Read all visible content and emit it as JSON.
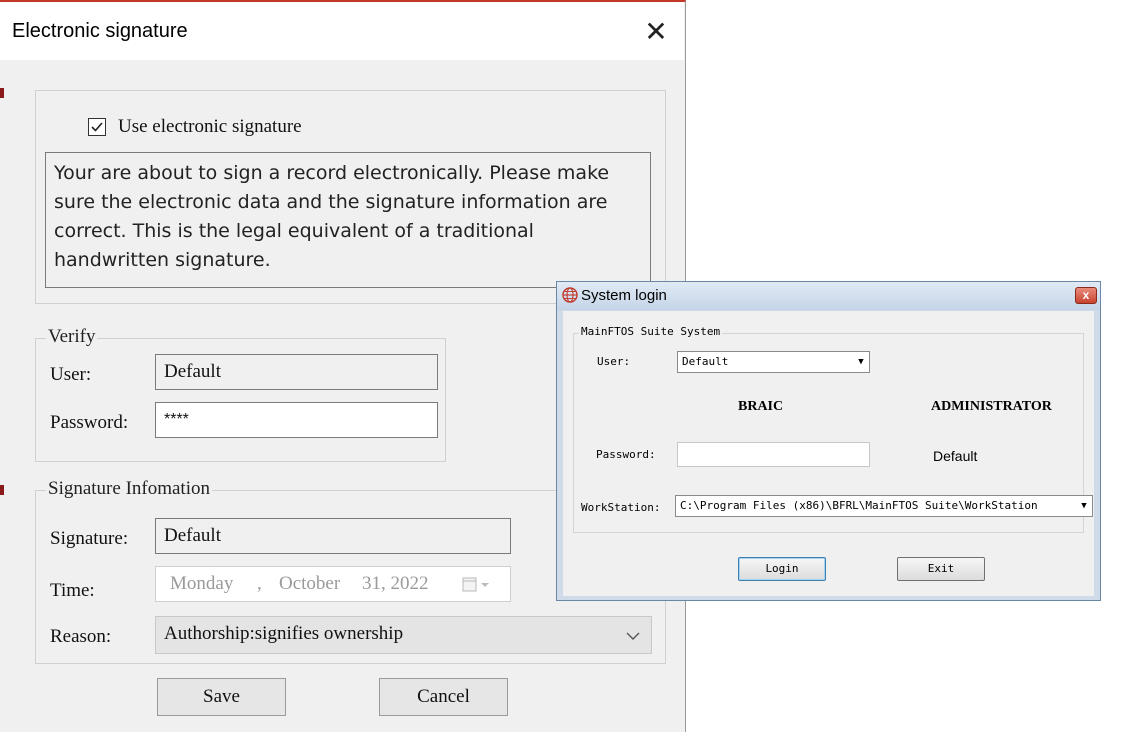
{
  "esig": {
    "title": "Electronic signature",
    "close_glyph": "✕",
    "use_signature_label": "Use electronic signature",
    "use_signature_checked": true,
    "notice": "Your are about to sign a record electronically. Please make sure the electronic data and the signature information are correct. This is the legal equivalent of a traditional handwritten signature.",
    "verify": {
      "legend": "Verify",
      "user_label": "User:",
      "user_value": "Default",
      "password_label": "Password:",
      "password_value": "****"
    },
    "signature_info": {
      "legend": "Signature Infomation",
      "signature_label": "Signature:",
      "signature_value": "Default",
      "time_label": "Time:",
      "time_day": "Monday",
      "time_sep": ",",
      "time_month": "October",
      "time_date": "31, 2022",
      "reason_label": "Reason:",
      "reason_value": "Authorship:signifies ownership"
    },
    "save_label": "Save",
    "cancel_label": "Cancel"
  },
  "login": {
    "title": "System login",
    "close_glyph": "x",
    "group_legend": "MainFTOS Suite System",
    "user_label": "User:",
    "user_value": "Default",
    "braic": "BRAIC",
    "administrator": "ADMINISTRATOR",
    "password_label": "Password:",
    "password_value": "",
    "password_hint": "Default",
    "workstation_label": "WorkStation:",
    "workstation_value": "C:\\Program Files (x86)\\BFRL\\MainFTOS Suite\\WorkStation",
    "login_label": "Login",
    "exit_label": "Exit"
  },
  "icons": {
    "checkbox": "check-icon",
    "dropdown": "chevron-down-icon",
    "calendar": "calendar-icon",
    "app": "globe-icon"
  },
  "colors": {
    "dialog_bg": "#f0f0f0",
    "login_frame": "#cfdbe8",
    "close_red": "#c8432e"
  }
}
